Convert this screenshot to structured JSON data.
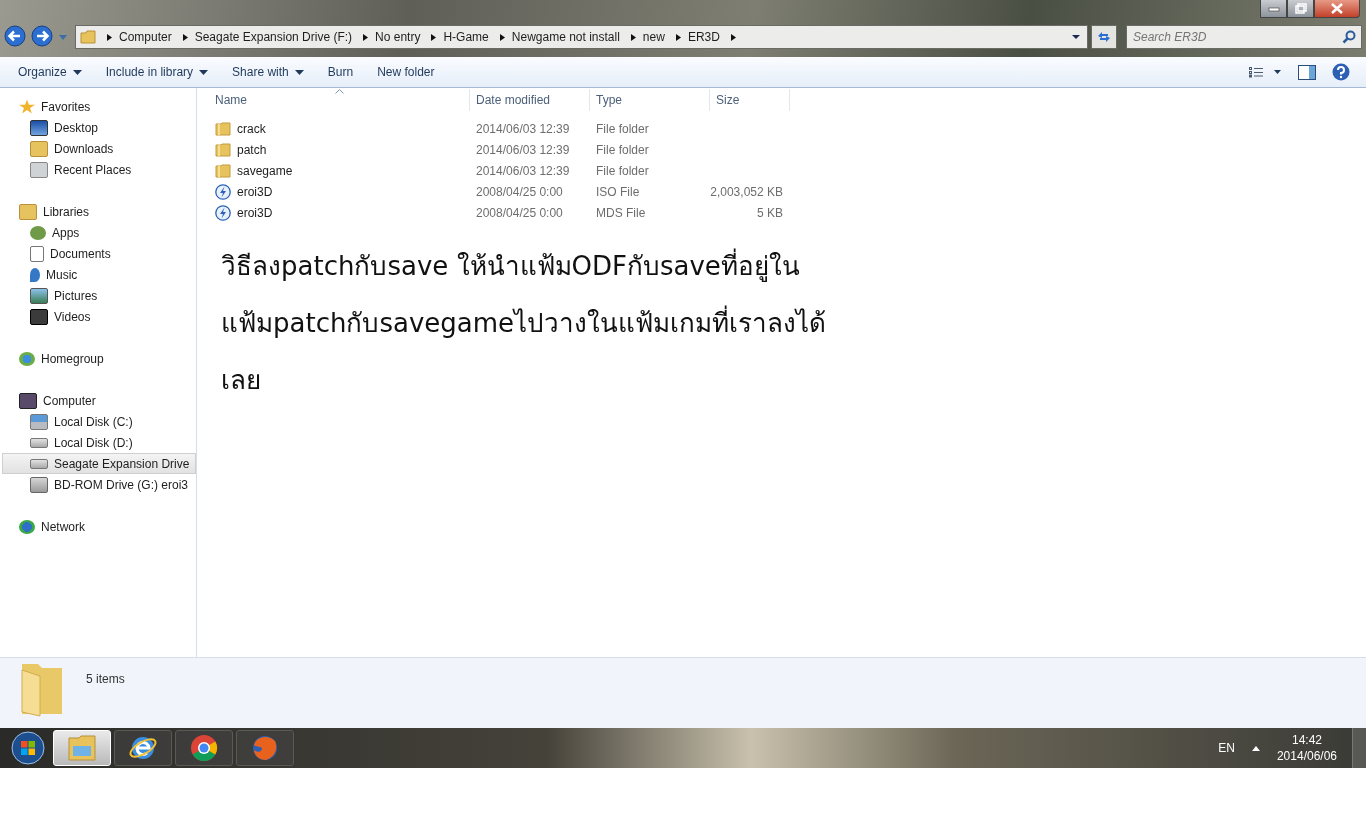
{
  "address_bar": {
    "crumbs": [
      "Computer",
      "Seagate Expansion Drive (F:)",
      "No entry",
      "H-Game",
      "Newgame not install",
      "new",
      "ER3D"
    ]
  },
  "search": {
    "placeholder": "Search ER3D"
  },
  "toolbar": {
    "buttons": [
      {
        "label": "Organize",
        "dropdown": true
      },
      {
        "label": "Include in library",
        "dropdown": true
      },
      {
        "label": "Share with",
        "dropdown": true
      },
      {
        "label": "Burn",
        "dropdown": false
      },
      {
        "label": "New folder",
        "dropdown": false
      }
    ]
  },
  "sidebar": {
    "groups": [
      {
        "label": "Favorites",
        "kind": "star",
        "children": [
          {
            "label": "Desktop",
            "kind": "desktop",
            "selected": false
          },
          {
            "label": "Downloads",
            "kind": "downloads",
            "selected": false
          },
          {
            "label": "Recent Places",
            "kind": "recent",
            "selected": false
          }
        ]
      },
      {
        "label": "Libraries",
        "kind": "library",
        "children": [
          {
            "label": "Apps",
            "kind": "apps",
            "selected": false
          },
          {
            "label": "Documents",
            "kind": "document",
            "selected": false
          },
          {
            "label": "Music",
            "kind": "music",
            "selected": false
          },
          {
            "label": "Pictures",
            "kind": "pictures",
            "selected": false
          },
          {
            "label": "Videos",
            "kind": "videos",
            "selected": false
          }
        ]
      },
      {
        "label": "Homegroup",
        "kind": "homegroup"
      },
      {
        "label": "Computer",
        "kind": "computer",
        "children": [
          {
            "label": "Local Disk (C:)",
            "kind": "sysdisk",
            "selected": false
          },
          {
            "label": "Local Disk (D:)",
            "kind": "disk",
            "selected": false
          },
          {
            "label": "Seagate Expansion Drive",
            "kind": "disk",
            "selected": true
          },
          {
            "label": "BD-ROM Drive (G:) eroi3",
            "kind": "optical",
            "selected": false
          }
        ]
      },
      {
        "label": "Network",
        "kind": "network"
      }
    ]
  },
  "table": {
    "columns": [
      "Name",
      "Date modified",
      "Type",
      "Size"
    ],
    "rows": [
      {
        "kind": "folder",
        "name": "crack",
        "date": "2014/06/03 12:39",
        "type": "File folder",
        "size": ""
      },
      {
        "kind": "folder",
        "name": "patch",
        "date": "2014/06/03 12:39",
        "type": "File folder",
        "size": ""
      },
      {
        "kind": "folder",
        "name": "savegame",
        "date": "2014/06/03 12:39",
        "type": "File folder",
        "size": ""
      },
      {
        "kind": "disc",
        "name": "eroi3D",
        "date": "2008/04/25 0:00",
        "type": "ISO File",
        "size": "2,003,052 KB"
      },
      {
        "kind": "disc",
        "name": "eroi3D",
        "date": "2008/04/25 0:00",
        "type": "MDS File",
        "size": "5 KB"
      }
    ]
  },
  "note": {
    "lines": [
      "วิธีลงpatchกับsave ให้นำแฟ้มODFกับsaveที่อยู่ใน",
      "แฟ้มpatchกับsavegameไปวางในแฟ้มเกมที่เราลงได้",
      "เลย"
    ]
  },
  "status_bar": {
    "count": "5 items"
  },
  "taskbar": {
    "apps": [
      {
        "kind": "explorer",
        "selected": true
      },
      {
        "kind": "ie",
        "selected": false
      },
      {
        "kind": "chrome",
        "selected": false
      },
      {
        "kind": "firefox",
        "selected": false
      }
    ],
    "language": "EN",
    "time": "14:42",
    "date": "2014/06/06"
  }
}
